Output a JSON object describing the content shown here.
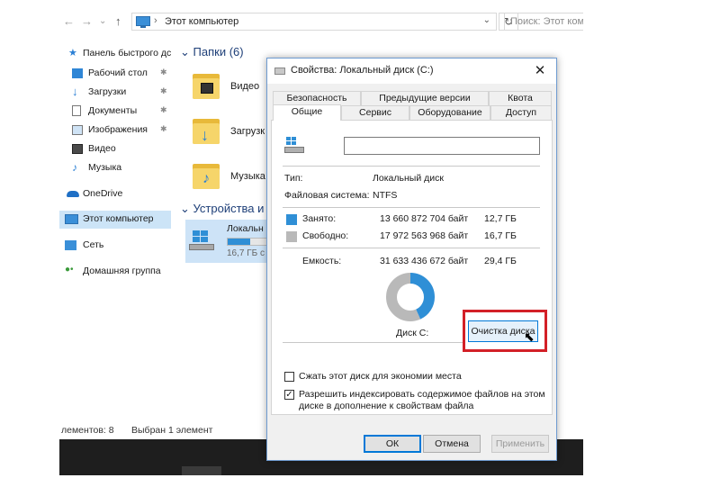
{
  "explorer": {
    "nav": {
      "back": "←",
      "forward": "→",
      "recent": "⌄",
      "up": "↑"
    },
    "address": {
      "separator": "›",
      "path": "Этот компьютер",
      "dropdown": "⌄",
      "refresh": "↻"
    },
    "search": {
      "placeholder": "Поиск: Этот ком"
    },
    "sidebar": {
      "items": [
        {
          "label": "Панель быстрого дс",
          "icon": "star-icon",
          "pinned": false
        },
        {
          "label": "Рабочий стол",
          "icon": "desktop-icon",
          "pinned": true
        },
        {
          "label": "Загрузки",
          "icon": "download-icon",
          "pinned": true
        },
        {
          "label": "Документы",
          "icon": "documents-icon",
          "pinned": true
        },
        {
          "label": "Изображения",
          "icon": "pictures-icon",
          "pinned": true
        },
        {
          "label": "Видео",
          "icon": "video-icon",
          "pinned": false
        },
        {
          "label": "Музыка",
          "icon": "music-icon",
          "pinned": false
        },
        {
          "label": "OneDrive",
          "icon": "onedrive-icon",
          "pinned": false
        },
        {
          "label": "Этот компьютер",
          "icon": "computer-icon",
          "pinned": false,
          "selected": true
        },
        {
          "label": "Сеть",
          "icon": "network-icon",
          "pinned": false
        },
        {
          "label": "Домашняя группа",
          "icon": "homegroup-icon",
          "pinned": false
        }
      ],
      "pin_glyph": "✱"
    },
    "content": {
      "folders_header": "Папки (6)",
      "folders": [
        {
          "label": "Видео",
          "icon": "video-folder-icon"
        },
        {
          "label": "Загрузк",
          "icon": "downloads-folder-icon"
        },
        {
          "label": "Музыка",
          "icon": "music-folder-icon"
        }
      ],
      "devices_header": "Устройства и",
      "drive": {
        "label": "Локальн",
        "free": "16,7 ГБ с",
        "used_fraction": 0.43
      }
    },
    "status": {
      "items": "лементов: 8",
      "selected": "Выбран 1 элемент"
    }
  },
  "dialog": {
    "title": "Свойства: Локальный диск (C:)",
    "close": "✕",
    "tabs_row1": [
      "Безопасность",
      "Предыдущие версии",
      "Квота"
    ],
    "tabs_row2": [
      "Общие",
      "Сервис",
      "Оборудование",
      "Доступ"
    ],
    "active_tab": "Общие",
    "drive_name_value": "",
    "type_label": "Тип:",
    "type_value": "Локальный диск",
    "fs_label": "Файловая система:",
    "fs_value": "NTFS",
    "used": {
      "label": "Занято:",
      "bytes": "13 660 872 704 байт",
      "size": "12,7 ГБ",
      "color": "#2f8fd6"
    },
    "free": {
      "label": "Свободно:",
      "bytes": "17 972 563 968 байт",
      "size": "16,7 ГБ",
      "color": "#b9b9b9"
    },
    "capacity": {
      "label": "Емкость:",
      "bytes": "31 633 436 672 байт",
      "size": "29,4 ГБ"
    },
    "chart_data": {
      "type": "pie",
      "categories": [
        "Занято",
        "Свободно"
      ],
      "values": [
        13660872704,
        17972563968
      ],
      "colors": [
        "#2f8fd6",
        "#b9b9b9"
      ],
      "title": "Диск C:"
    },
    "disk_label": "Диск C:",
    "cleanup_button": "Очистка диска",
    "compress_checkbox": {
      "label": "Сжать этот диск для экономии места",
      "checked": false
    },
    "index_checkbox": {
      "line1": "Разрешить индексировать содержимое файлов на этом",
      "line2": "диске в дополнение к свойствам файла",
      "checked": true,
      "mark": "✓"
    },
    "buttons": {
      "ok": "ОК",
      "cancel": "Отмена",
      "apply": "Применить"
    }
  }
}
